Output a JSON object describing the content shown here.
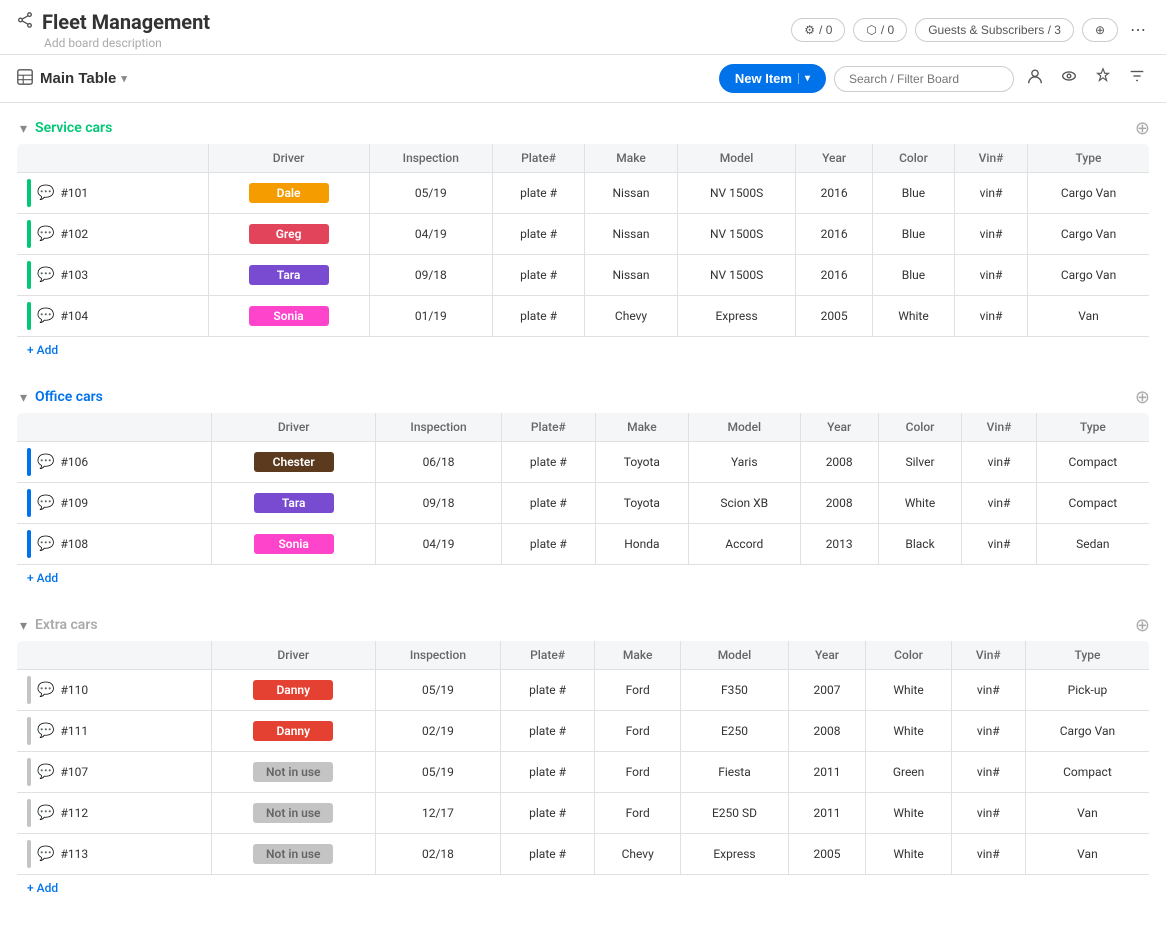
{
  "app": {
    "title": "Fleet Management",
    "board_desc": "Add board description",
    "share_icon": "↗"
  },
  "header": {
    "automations_label": "/ 0",
    "integrations_label": "/ 0",
    "guests_label": "Guests & Subscribers / 3",
    "more_icon": "⋯"
  },
  "toolbar": {
    "main_table_label": "Main Table",
    "new_item_label": "New Item",
    "search_placeholder": "Search / Filter Board"
  },
  "groups": [
    {
      "id": "service",
      "name": "Service cars",
      "color_class": "service",
      "accent_class": "accent-green",
      "columns": [
        "Driver",
        "Inspection",
        "Plate#",
        "Make",
        "Model",
        "Year",
        "Color",
        "Vin#",
        "Type"
      ],
      "rows": [
        {
          "id": "#101",
          "driver": "Dale",
          "driver_class": "badge-orange",
          "inspection": "05/19",
          "plate": "plate #",
          "make": "Nissan",
          "model": "NV 1500S",
          "year": "2016",
          "color": "Blue",
          "vin": "vin#",
          "type": "Cargo Van"
        },
        {
          "id": "#102",
          "driver": "Greg",
          "driver_class": "badge-red",
          "inspection": "04/19",
          "plate": "plate #",
          "make": "Nissan",
          "model": "NV 1500S",
          "year": "2016",
          "color": "Blue",
          "vin": "vin#",
          "type": "Cargo Van"
        },
        {
          "id": "#103",
          "driver": "Tara",
          "driver_class": "badge-purple",
          "inspection": "09/18",
          "plate": "plate #",
          "make": "Nissan",
          "model": "NV 1500S",
          "year": "2016",
          "color": "Blue",
          "vin": "vin#",
          "type": "Cargo Van"
        },
        {
          "id": "#104",
          "driver": "Sonia",
          "driver_class": "badge-pink",
          "inspection": "01/19",
          "plate": "plate #",
          "make": "Chevy",
          "model": "Express",
          "year": "2005",
          "color": "White",
          "vin": "vin#",
          "type": "Van"
        }
      ],
      "add_label": "+ Add"
    },
    {
      "id": "office",
      "name": "Office cars",
      "color_class": "office",
      "accent_class": "accent-blue",
      "columns": [
        "Driver",
        "Inspection",
        "Plate#",
        "Make",
        "Model",
        "Year",
        "Color",
        "Vin#",
        "Type"
      ],
      "rows": [
        {
          "id": "#106",
          "driver": "Chester",
          "driver_class": "badge-brown",
          "inspection": "06/18",
          "plate": "plate #",
          "make": "Toyota",
          "model": "Yaris",
          "year": "2008",
          "color": "Silver",
          "vin": "vin#",
          "type": "Compact"
        },
        {
          "id": "#109",
          "driver": "Tara",
          "driver_class": "badge-purple",
          "inspection": "09/18",
          "plate": "plate #",
          "make": "Toyota",
          "model": "Scion XB",
          "year": "2008",
          "color": "White",
          "vin": "vin#",
          "type": "Compact"
        },
        {
          "id": "#108",
          "driver": "Sonia",
          "driver_class": "badge-pink",
          "inspection": "04/19",
          "plate": "plate #",
          "make": "Honda",
          "model": "Accord",
          "year": "2013",
          "color": "Black",
          "vin": "vin#",
          "type": "Sedan"
        }
      ],
      "add_label": "+ Add"
    },
    {
      "id": "extra",
      "name": "Extra cars",
      "color_class": "extra",
      "accent_class": "accent-gray",
      "columns": [
        "Driver",
        "Inspection",
        "Plate#",
        "Make",
        "Model",
        "Year",
        "Color",
        "Vin#",
        "Type"
      ],
      "rows": [
        {
          "id": "#110",
          "driver": "Danny",
          "driver_class": "badge-orange2",
          "inspection": "05/19",
          "plate": "plate #",
          "make": "Ford",
          "model": "F350",
          "year": "2007",
          "color": "White",
          "vin": "vin#",
          "type": "Pick-up"
        },
        {
          "id": "#111",
          "driver": "Danny",
          "driver_class": "badge-orange2",
          "inspection": "02/19",
          "plate": "plate #",
          "make": "Ford",
          "model": "E250",
          "year": "2008",
          "color": "White",
          "vin": "vin#",
          "type": "Cargo Van"
        },
        {
          "id": "#107",
          "driver": "Not in use",
          "driver_class": "badge-gray",
          "inspection": "05/19",
          "plate": "plate #",
          "make": "Ford",
          "model": "Fiesta",
          "year": "2011",
          "color": "Green",
          "vin": "vin#",
          "type": "Compact"
        },
        {
          "id": "#112",
          "driver": "Not in use",
          "driver_class": "badge-gray",
          "inspection": "12/17",
          "plate": "plate #",
          "make": "Ford",
          "model": "E250 SD",
          "year": "2011",
          "color": "White",
          "vin": "vin#",
          "type": "Van"
        },
        {
          "id": "#113",
          "driver": "Not in use",
          "driver_class": "badge-gray",
          "inspection": "02/18",
          "plate": "plate #",
          "make": "Chevy",
          "model": "Express",
          "year": "2005",
          "color": "White",
          "vin": "vin#",
          "type": "Van"
        }
      ],
      "add_label": "+ Add"
    }
  ]
}
